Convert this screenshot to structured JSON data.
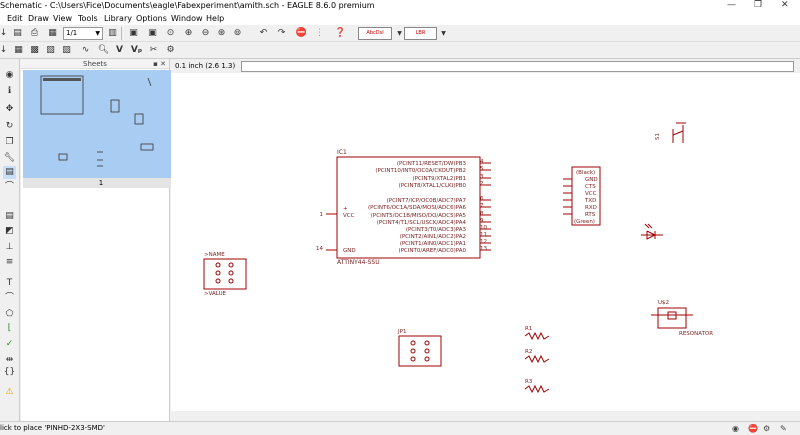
{
  "window": {
    "title": "Schematic - C:\\Users\\Fice\\Documents\\eagle\\Fabexperiment\\amith.sch - EAGLE 8.6.0 premium",
    "minimize_glyph": "—",
    "maximize_glyph": "❐",
    "close_glyph": "✕"
  },
  "menu": [
    "Edit",
    "Draw",
    "View",
    "Tools",
    "Library",
    "Options",
    "Window",
    "Help"
  ],
  "toolbar": {
    "sheet_select": "1/1",
    "lib_button_1": "AbcDsl",
    "lib_button_2": "LBR"
  },
  "sheets_panel": {
    "title": "Sheets",
    "sheet_label": "1"
  },
  "command": {
    "coordinate": "0.1 inch (2.6 1.3)",
    "input_value": ""
  },
  "status": {
    "message": "lick to place 'PINHD-2X3-SMD'"
  },
  "schematic": {
    "ic1": {
      "name": "IC1",
      "value": "ATTINY44-SSU",
      "vcc": "VCC",
      "gnd": "GND",
      "vcc_pin": "1",
      "gnd_pin": "14",
      "plus": "+",
      "pins": [
        {
          "label": "(PCINT11/RESET/DW)PB3",
          "num": "4"
        },
        {
          "label": "(PCINT10/INT0/OC0A/CKOUT)PB2",
          "num": "5"
        },
        {
          "label": "(PCINT9/XTAL2)PB1",
          "num": "3"
        },
        {
          "label": "(PCINT8/XTAL1/CLKI)PB0",
          "num": "2"
        },
        {
          "label": "(PCINT7/ICP/OC0B/ADC7)PA7",
          "num": "6"
        },
        {
          "label": "(PCINT6/OC1A/SDA/MOSI/ADC6)PA6",
          "num": "7"
        },
        {
          "label": "(PCINT5/OC1B/MISO/DO/ADC5)PA5",
          "num": "8"
        },
        {
          "label": "(PCINT4/T1/SCL/USCK/ADC4)PA4",
          "num": "9"
        },
        {
          "label": "(PCINT3/T0/ADC3)PA3",
          "num": "10"
        },
        {
          "label": "(PCINT2/AIN1/ADC2)PA2",
          "num": "11"
        },
        {
          "label": "(PCINT1/AIN0/ADC1)PA1",
          "num": "12"
        },
        {
          "label": "(PCINT0/AREF/ADC0)PA0",
          "num": "13"
        }
      ]
    },
    "ftdi": {
      "labels": [
        "(Black)",
        "GND",
        "CTS",
        "VCC",
        "TXD",
        "RXD",
        "RTS",
        "(Green)"
      ]
    },
    "header1": {
      "name": ">NAME",
      "value": ">VALUE"
    },
    "jp1": {
      "name": "JP1"
    },
    "s1": {
      "name": "S1"
    },
    "resonator": {
      "name": "U$2",
      "value": "RESONATOR"
    },
    "resistors": [
      {
        "name": "R1"
      },
      {
        "name": "R2"
      },
      {
        "name": "R3"
      }
    ]
  }
}
